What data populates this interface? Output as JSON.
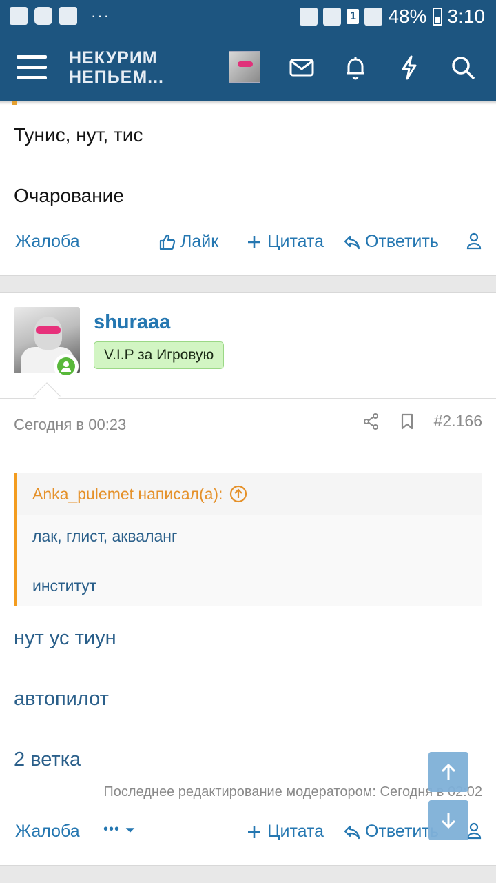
{
  "status_bar": {
    "battery": "48%",
    "time": "3:10",
    "notification_count": "1",
    "more": "···"
  },
  "app_bar": {
    "logo_line1": "НЕКУРИМ",
    "logo_line2": "НЕПЬЕМ..."
  },
  "post1": {
    "line1": "Тунис, нут, тис",
    "line2": "Очарование",
    "actions": {
      "report": "Жалоба",
      "like": "Лайк",
      "quote": "Цитата",
      "reply": "Ответить"
    }
  },
  "post2": {
    "username": "shuraaa",
    "badge": "V.I.P за Игровую",
    "timestamp": "Сегодня в 00:23",
    "post_number": "#2.166",
    "quote": {
      "author": "Anka_pulemet написал(а):",
      "line1": "лак, глист, акваланг",
      "line2": "институт"
    },
    "body": [
      "нут ус тиун",
      "автопилот",
      "2 ветка"
    ],
    "edited_note": "Последнее редактирование модератором: Сегодня в 02:02",
    "actions": {
      "report": "Жалоба",
      "more": "•••",
      "quote": "Цитата",
      "reply": "Ответить"
    }
  },
  "colors": {
    "header": "#1d5580",
    "link": "#2577b1",
    "quote_accent": "#f39c1f",
    "badge_bg": "#d2f5c3"
  }
}
